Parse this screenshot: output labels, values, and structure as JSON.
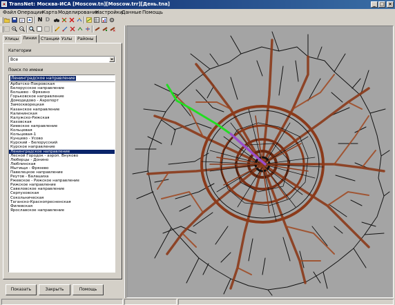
{
  "window": {
    "title": "TransNet: Москва-ИСА [Moscow.tn][Moscow.trr][День.tna]",
    "minimize": "_",
    "maximize": "□",
    "close": "×"
  },
  "menu": [
    "Файл",
    "Операции",
    "Карта",
    "Моделирование",
    "Настройки",
    "Данные",
    "Помощь"
  ],
  "toolbar": {
    "n_label": "N",
    "d_label": "D"
  },
  "tabs": [
    "Улицы",
    "Линии",
    "Станции",
    "Узлы",
    "Районы"
  ],
  "active_tab": "Линии",
  "category": {
    "label": "Категории",
    "value": "Все"
  },
  "search": {
    "label": "Поиск по имени",
    "value": "Ленинградское направление"
  },
  "lines": [
    "Арбатско-Покровская",
    "Белорусское направление",
    "Болшево - Фрязино",
    "Горьковское направление",
    "Домодедово - Аэропорт",
    "Замоскворецкая",
    "Казанское направление",
    "Калининская",
    "Калужско-Рижская",
    "Каховская",
    "Киевское направление",
    "Кольцевая",
    "Кольцевая-1",
    "Кунцево - Усово",
    "Курский - Белорусский",
    "Курское направление",
    "Ленинградское направление",
    "Лесной Городок - аэроп. Внуково",
    "Люберцы - Донино",
    "Люблинская",
    "Мытищи - Фрязево",
    "Павелецкое направление",
    "Реутов - Балашиха",
    "Ржевское - Рижское направление",
    "Рижское направление",
    "Савеловское направление",
    "Серпуховская",
    "Сокольническая",
    "Таганско-Краснопресненская",
    "Филевская",
    "Ярославское направление"
  ],
  "selected_line": "Ленинградское направление",
  "buttons": {
    "show": "Показать",
    "close": "Закрыть",
    "help": "Помощь"
  },
  "colors": {
    "title_bar": "#0a246a",
    "map_bg": "#a4a4a4",
    "road_black": "#111111",
    "flow_brown": "#8b3a1a",
    "highlight_green": "#22dd22",
    "highlight_purple": "#9b4dca"
  }
}
